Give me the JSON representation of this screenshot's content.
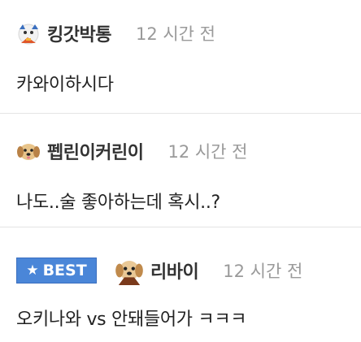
{
  "comments": [
    {
      "avatar_icon": "cartoon-avatar-icon",
      "nickname": "킹갓박통",
      "time": "12 시간 전",
      "text": "카와이하시다",
      "best": false
    },
    {
      "avatar_icon": "puppy-avatar-icon",
      "nickname": "펩린이커린이",
      "time": "12 시간 전",
      "text": "나도..술 좋아하는데 혹시..?",
      "best": false
    },
    {
      "avatar_icon": "puppy-avatar-icon",
      "nickname": "리바이",
      "time": "12 시간 전",
      "text": "오키나와 vs 안돼들어가 ㅋㅋㅋ",
      "best": true,
      "badge_label": "BEST",
      "badge_icon": "star-icon"
    }
  ],
  "colors": {
    "best_badge": "#4a86d8",
    "time_text": "#9a9a9a",
    "divider": "#e4e4e4"
  }
}
